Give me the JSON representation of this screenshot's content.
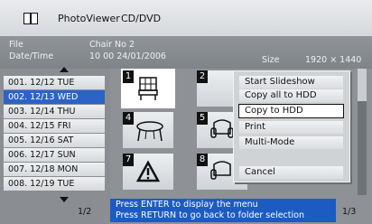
{
  "header": {
    "title": "PhotoViewer",
    "subtitle": "CD/DVD"
  },
  "info": {
    "file_label": "File",
    "file_value": "Chair No  2",
    "date_label": "Date/Time",
    "date_value": "10 00  24/01/2006",
    "size_label": "Size",
    "size_value": "1920 × 1440"
  },
  "folders": [
    "001. 12/12 TUE",
    "002. 12/13 WED",
    "003. 12/14 THU",
    "004. 12/15 FRI",
    "005. 12/16 SAT",
    "006. 12/17 SUN",
    "007. 12/18 MON",
    "008. 12/19 TUE"
  ],
  "selected_folder_index": 1,
  "list_page": "1/2",
  "thumbnails": [
    {
      "number": "1",
      "icon": "chair-icon",
      "selected": true
    },
    {
      "number": "2",
      "icon": "blank",
      "selected": false
    },
    {
      "number": "4",
      "icon": "table-icon",
      "selected": false
    },
    {
      "number": "5",
      "icon": "armchair-icon",
      "selected": false
    },
    {
      "number": "7",
      "icon": "warning-icon",
      "selected": false
    },
    {
      "number": "8",
      "icon": "armchair-icon",
      "selected": false
    }
  ],
  "menu": {
    "items": [
      "Start Slideshow",
      "Copy all to HDD",
      "Copy to HDD",
      "Print",
      "Multi-Mode",
      "Cancel"
    ],
    "selected_index": 2
  },
  "message": {
    "line1": "Press ENTER to display the menu",
    "line2": "Press RETURN to go back to folder selection"
  },
  "page_indicator": "1/3",
  "colors": {
    "accent": "#2c63c5",
    "background": "#8e9296"
  }
}
